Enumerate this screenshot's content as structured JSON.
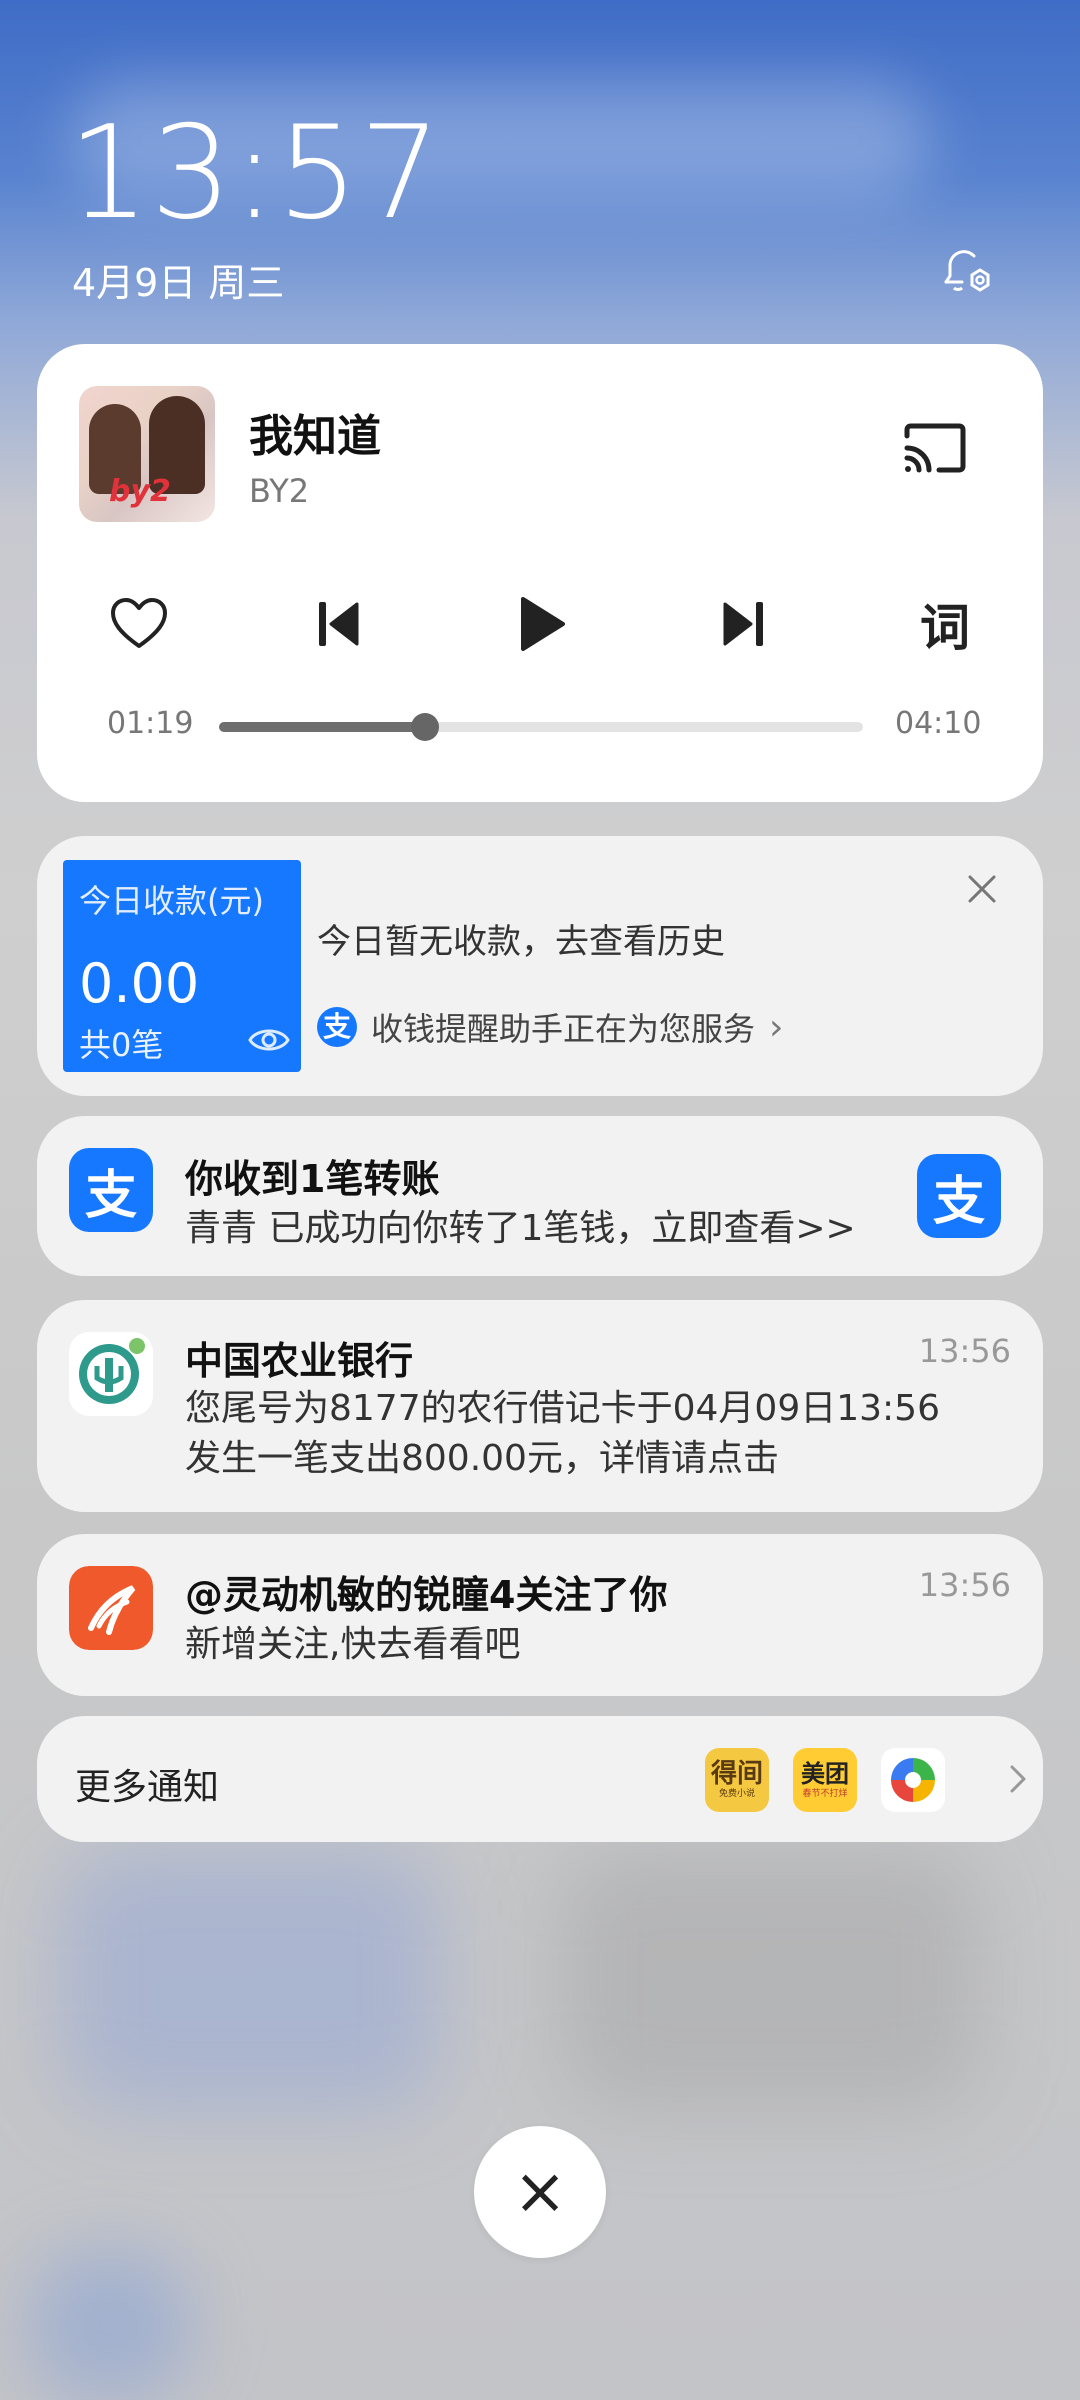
{
  "lockscreen": {
    "time": "13:57",
    "date": "4月9日 周三"
  },
  "music": {
    "song": "我知道",
    "artist": "BY2",
    "elapsed": "01:19",
    "duration": "04:10",
    "progress": 0.32,
    "lyrics_label": "词",
    "cover_logo": "by2"
  },
  "payment": {
    "box_label": "今日收款(元)",
    "amount": "0.00",
    "count": "共0笔",
    "message": "今日暂无收款，去查看历史",
    "assistant": "收钱提醒助手正在为您服务",
    "assistant_chevron": "›",
    "accent": "#1677ff"
  },
  "notifications": [
    {
      "app": "alipay",
      "title": "你收到1笔转账",
      "body": "青青 已成功向你转了1笔钱，立即查看>>",
      "icon_char": "支"
    },
    {
      "app": "abc-bank",
      "title": "中国农业银行",
      "time": "13:56",
      "body1": "您尾号为8177的农行借记卡于04月09日13:56",
      "body2": "发生一笔支出800.00元，详情请点击"
    },
    {
      "app": "social",
      "title": "@灵动机敏的锐瞳4关注了你",
      "time": "13:56",
      "body": "新增关注,快去看看吧"
    }
  ],
  "more": {
    "label": "更多通知",
    "icons": [
      {
        "name": "dewen",
        "text": "得间",
        "sub": "免费小说"
      },
      {
        "name": "meituan",
        "text": "美团",
        "sub": "春节不打烊"
      },
      {
        "name": "browser"
      }
    ]
  },
  "close_button": "×"
}
